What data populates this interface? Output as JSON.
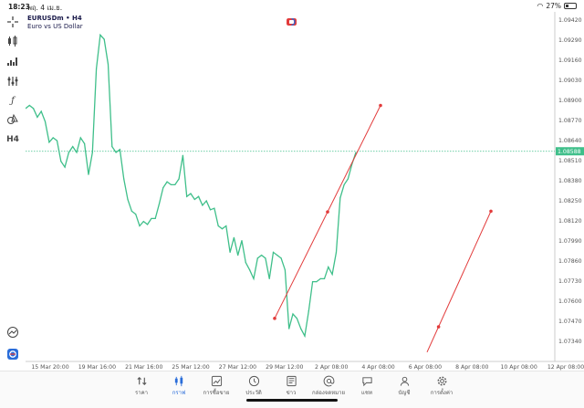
{
  "status": {
    "time": "18:23",
    "date": "พฤ. 4 เม.ย.",
    "battery": "27%",
    "battery_level": 0.27
  },
  "symbol": {
    "name": "EURUSDm • H4",
    "description": "Euro vs US Dollar"
  },
  "toolbar": {
    "timeframe": "H4"
  },
  "chart_data": {
    "type": "line",
    "y_ticks": [
      "1.09420",
      "1.09290",
      "1.09160",
      "1.09030",
      "1.08900",
      "1.08770",
      "1.08640",
      "1.08510",
      "1.08380",
      "1.08250",
      "1.08120",
      "1.07990",
      "1.07860",
      "1.07730",
      "1.07600",
      "1.07470",
      "1.07340"
    ],
    "x_ticks": [
      "15 Mar 20:00",
      "19 Mar 16:00",
      "21 Mar 16:00",
      "25 Mar 12:00",
      "27 Mar 12:00",
      "29 Mar 12:00",
      "2 Apr 08:00",
      "4 Apr 08:00",
      "6 Apr 08:00",
      "8 Apr 08:00",
      "10 Apr 08:00",
      "12 Apr 08:00"
    ],
    "current_price": "1.08588",
    "current_price_value": 1.08588,
    "ylim": [
      1.0725,
      1.095
    ],
    "grid": false,
    "series": [
      {
        "color": "#3fbf8a",
        "values": [
          1.0888,
          1.089,
          1.0888,
          1.0882,
          1.0886,
          1.0879,
          1.0865,
          1.0868,
          1.0866,
          1.0852,
          1.0848,
          1.0858,
          1.0862,
          1.0858,
          1.0868,
          1.0864,
          1.0843,
          1.0858,
          1.0915,
          1.0938,
          1.0935,
          1.0918,
          1.0862,
          1.0858,
          1.086,
          1.084,
          1.0826,
          1.0818,
          1.0816,
          1.0808,
          1.0811,
          1.0809,
          1.0813,
          1.0813,
          1.0823,
          1.0834,
          1.0838,
          1.0836,
          1.0836,
          1.084,
          1.0856,
          1.0828,
          1.083,
          1.0826,
          1.0828,
          1.0822,
          1.0825,
          1.0819,
          1.082,
          1.0808,
          1.0806,
          1.0808,
          1.079,
          1.08,
          1.0788,
          1.0798,
          1.0783,
          1.0778,
          1.0772,
          1.0786,
          1.0788,
          1.0786,
          1.0772,
          1.079,
          1.0788,
          1.0786,
          1.0778,
          1.0738,
          1.0748,
          1.0745,
          1.0738,
          1.0733,
          1.075,
          1.077,
          1.077,
          1.0772,
          1.0772,
          1.078,
          1.0775,
          1.079,
          1.0827,
          1.0836,
          1.084,
          1.085,
          1.0858
        ]
      }
    ],
    "trendlines": [
      {
        "color": "#e23b3b",
        "from": [
          1.0745
        ],
        "to": [
          1.089
        ]
      },
      {
        "color": "#e23b3b",
        "from": [
          1.0722
        ],
        "to": [
          1.0818
        ]
      }
    ]
  },
  "nav": {
    "items": [
      {
        "label": "ราคา",
        "icon": "arrows-updown-icon"
      },
      {
        "label": "กราฟ",
        "icon": "candles-icon"
      },
      {
        "label": "การซื้อขาย",
        "icon": "trade-chart-icon"
      },
      {
        "label": "ประวัติ",
        "icon": "history-icon"
      },
      {
        "label": "ข่าว",
        "icon": "news-icon"
      },
      {
        "label": "กล่องจดหมาย",
        "icon": "mailbox-icon"
      },
      {
        "label": "แชท",
        "icon": "chat-icon"
      },
      {
        "label": "บัญชี",
        "icon": "account-icon"
      },
      {
        "label": "การตั้งค่า",
        "icon": "settings-icon"
      }
    ],
    "active_index": 1
  }
}
